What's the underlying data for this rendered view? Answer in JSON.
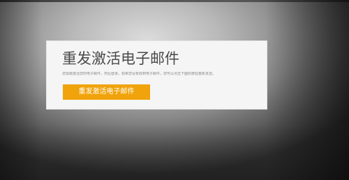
{
  "dialog": {
    "title": "重发激活电子邮件",
    "description": "您需要激活您的电子邮件，然后登录。如果您没有收到电子邮件，您可以点击下面的按钮重新发送。",
    "resend_button_label": "重发激活电子邮件"
  },
  "colors": {
    "accent": "#f0a30a",
    "card_background": "#f5f5f5",
    "title_text": "#4a4a4a"
  }
}
